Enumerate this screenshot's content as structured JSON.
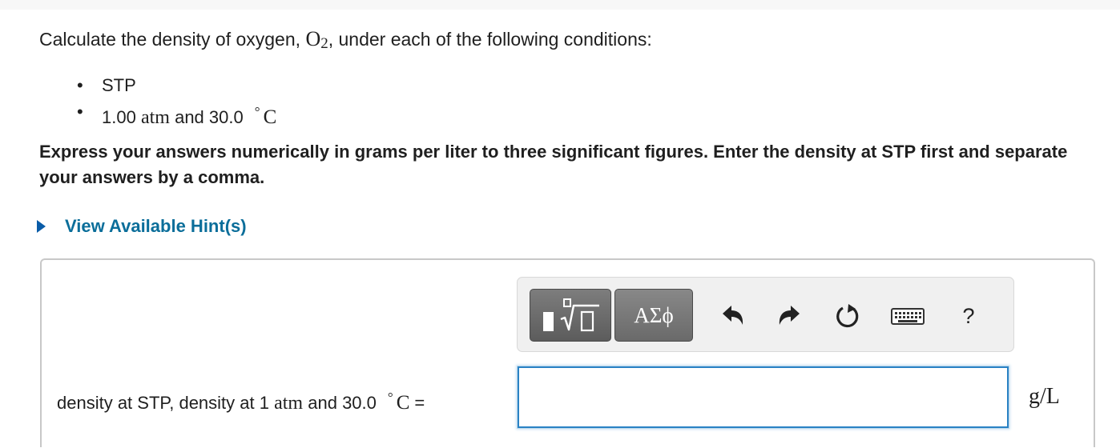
{
  "question": {
    "prefix": "Calculate the density of oxygen,",
    "formula_base": "O",
    "formula_sub": "2",
    "suffix": ", under each of the following conditions:"
  },
  "conditions": {
    "item1": "STP",
    "item2_value": "1.00",
    "item2_unit": "atm",
    "item2_and": "and",
    "item2_temp": "30.0",
    "degree": "°",
    "celsius": "C"
  },
  "instructions": "Express your answers numerically in grams per liter to three significant figures. Enter the density at STP first and separate your answers by a comma.",
  "hint": {
    "label": "View Available Hint(s)"
  },
  "toolbar": {
    "greek_label": "ΑΣϕ",
    "help_label": "?"
  },
  "answer": {
    "label_prefix": "density at STP, density at 1",
    "label_unit": "atm",
    "label_and": "and",
    "label_temp": "30.0",
    "degree": "°",
    "celsius": "C",
    "equals": "=",
    "input_value": "",
    "units": "g/L"
  },
  "colors": {
    "hint_link": "#0b6e9a",
    "input_border": "#2a82c4",
    "toolbar_bg": "#f0f0f0"
  }
}
